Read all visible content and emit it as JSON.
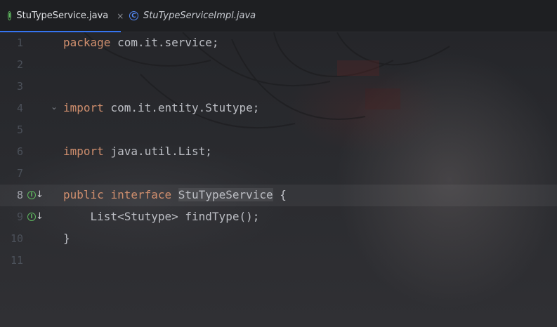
{
  "tabs": [
    {
      "label": "StuTypeService.java",
      "icon": "interface-icon",
      "icon_glyph": "I",
      "active": true,
      "close": "×"
    },
    {
      "label": "StuTypeServiceImpl.java",
      "icon": "class-icon",
      "icon_glyph": "C",
      "active": false
    }
  ],
  "gutter_icon_glyph": "I",
  "gutter_arrow": "↓",
  "fold_glyph": "⌄",
  "lines": [
    {
      "n": "1",
      "kw": "package",
      "rest": " com.it.service;"
    },
    {
      "n": "2"
    },
    {
      "n": "3"
    },
    {
      "n": "4",
      "kw": "import",
      "rest": " com.it.entity.Stutype;"
    },
    {
      "n": "5"
    },
    {
      "n": "6",
      "kw": "import",
      "rest": " java.util.List;"
    },
    {
      "n": "7"
    },
    {
      "n": "8",
      "kw1": "public",
      "kw2": "interface",
      "name": "StuTypeService",
      "rest": " {"
    },
    {
      "n": "9",
      "rest": "    List<Stutype> findType();"
    },
    {
      "n": "10",
      "rest": "}"
    },
    {
      "n": "11"
    }
  ],
  "colors": {
    "keyword": "#cf8e6d",
    "text": "#bcbec4",
    "tab_underline": "#3574f0",
    "interface_icon": "#5fb85f",
    "class_icon": "#548af7"
  }
}
